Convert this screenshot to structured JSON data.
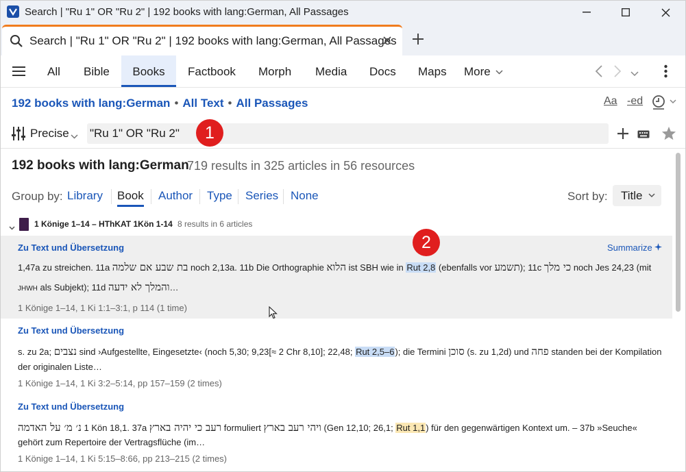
{
  "window": {
    "title": "Search | \"Ru 1\" OR \"Ru 2\" | 192 books with lang:German, All Passages"
  },
  "tab": {
    "label": "Search | \"Ru 1\" OR \"Ru 2\" | 192 books with lang:German, All Passages"
  },
  "nav": {
    "items": [
      "All",
      "Bible",
      "Books",
      "Factbook",
      "Morph",
      "Media",
      "Docs",
      "Maps",
      "More"
    ],
    "active": "Books"
  },
  "breadcrumb": {
    "collection": "192 books with lang:German",
    "text": "All Text",
    "passages": "All Passages"
  },
  "toolbar": {
    "aa": "Aa",
    "ed": "-ed"
  },
  "search": {
    "mode": "Precise",
    "query": "\"Ru 1\" OR \"Ru 2\""
  },
  "callouts": [
    "1",
    "2"
  ],
  "results": {
    "title": "192 books with lang:German",
    "summary": "719 results in 325 articles in 56 resources"
  },
  "groupby": {
    "label": "Group by:",
    "options": [
      "Library",
      "Book",
      "Author",
      "Type",
      "Series",
      "None"
    ],
    "active": "Book"
  },
  "sortby": {
    "label": "Sort by:",
    "value": "Title"
  },
  "book": {
    "title": "1 Könige 1–14 – HThKAT 1Kön 1-14",
    "count": "8 results in 6 articles"
  },
  "result_items": [
    {
      "heading": "Zu Text und Übersetzung",
      "summarize": "Summarize",
      "l1a": "1,47a zu streichen. 11a ",
      "l1heb1": "בת שבע אם שלמה",
      "l1b": " noch 2,13a. 11b Die Orthographie ",
      "l1heb2": "הלוא",
      "l1c": " ist SBH wie in ",
      "l1hit": "Rut 2,8",
      "l1d": " (ebenfalls vor ",
      "l1heb3": "תשמע",
      "l1e": "); 11c ",
      "l1heb4": "כי מלך",
      "l1f": " noch Jes 24,23 (mit",
      "l2sc": "JHWH",
      "l2a": " als Subjekt); 11d ",
      "l2heb": "והמלך לא ידעה",
      "l2b": "…",
      "meta": "1 Könige 1–14, 1 Ki 1:1–3:1, p 114 (1 time)"
    },
    {
      "heading": "Zu Text und Übersetzung",
      "l1a": "s. zu 2a; ",
      "l1heb1": "נצבים",
      "l1b": " sind ›Aufgestellte, Eingesetzte‹ (noch 5,30; 9,23[≈ 2 Chr 8,10]; 22,48; ",
      "l1hit": "Rut 2,5–6",
      "l1c": "); die Termini ",
      "l1heb2": "סוכן",
      "l1d": " (s. zu 1,2d) und ",
      "l1heb3": "פחה",
      "l1e": " standen bei der Kompilation",
      "l2a": "der originalen Liste…",
      "meta": "1 Könige 1–14, 1 Ki 3:2–5:14, pp 157–159 (2 times)"
    },
    {
      "heading": "Zu Text und Übersetzung",
      "l1heb1": "נ׳ מ׳ על האדמה",
      "l1a": " 1 Kön 18,1. 37a ",
      "l1heb2": "רעב כי יהיה בארץ",
      "l1b": " formuliert ",
      "l1heb3": "ויהי רעב בארץ",
      "l1c": " (Gen 12,10; 26,1; ",
      "l1hit": "Rut 1,1",
      "l1d": ") für den gegenwärtigen Kontext um. – 37b »Seuche«",
      "l2a": "gehört zum Repertoire der Vertragsflüche (im…",
      "meta": "1 Könige 1–14, 1 Ki 5:15–8:66, pp 213–215 (2 times)"
    }
  ]
}
